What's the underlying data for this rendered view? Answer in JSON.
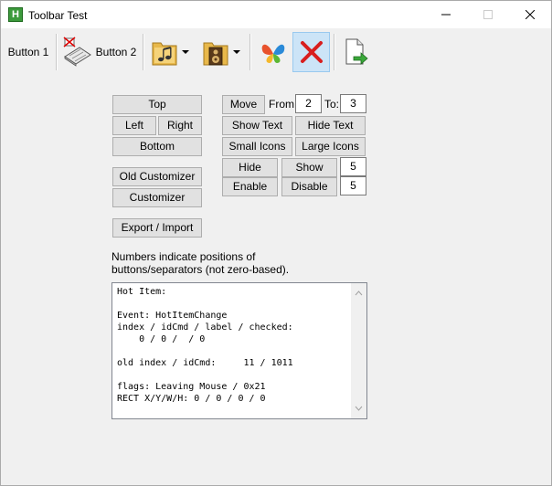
{
  "window": {
    "title": "Toolbar Test",
    "app_icon_letter": "H"
  },
  "toolbar": {
    "button1_label": "Button 1",
    "button2_label": "Button 2"
  },
  "controls": {
    "top": "Top",
    "left": "Left",
    "right": "Right",
    "bottom": "Bottom",
    "old_customizer": "Old Customizer",
    "customizer": "Customizer",
    "export_import": "Export / Import",
    "move": "Move",
    "from_label": "From:",
    "from_value": "2",
    "to_label": "To:",
    "to_value": "3",
    "show_text": "Show Text",
    "hide_text": "Hide Text",
    "small_icons": "Small Icons",
    "large_icons": "Large Icons",
    "hide": "Hide",
    "show": "Show",
    "hide_show_value": "5",
    "enable": "Enable",
    "disable": "Disable",
    "enable_disable_value": "5"
  },
  "note_line1": "Numbers indicate positions of",
  "note_line2": "buttons/separators (not zero-based).",
  "log_text": "Hot Item:\n\nEvent: HotItemChange\nindex / idCmd / label / checked:\n    0 / 0 /  / 0\n\nold index / idCmd:     11 / 1011\n\nflags: Leaving Mouse / 0x21\nRECT X/Y/W/H: 0 / 0 / 0 / 0"
}
